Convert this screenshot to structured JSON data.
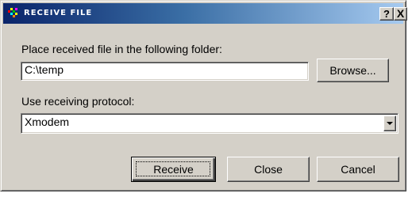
{
  "window": {
    "title": "RECEIVE FILE",
    "help_label": "?",
    "close_label": "X"
  },
  "folder": {
    "label": "Place received file in the following folder:",
    "value": "C:\\temp",
    "browse_label": "Browse..."
  },
  "protocol": {
    "label": "Use receiving protocol:",
    "selected": "Xmodem"
  },
  "buttons": {
    "receive": "Receive",
    "close": "Close",
    "cancel": "Cancel"
  },
  "colors": {
    "title_gradient_start": "#0a246a",
    "title_gradient_end": "#a6caf0",
    "face": "#d4d0c8"
  }
}
